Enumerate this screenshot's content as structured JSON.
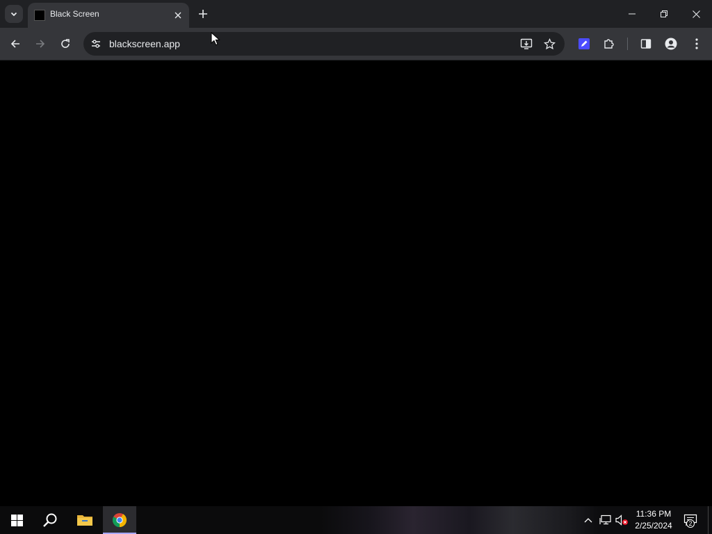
{
  "browser": {
    "tab": {
      "title": "Black Screen",
      "favicon": "black-square-icon"
    },
    "address_bar": {
      "url": "blackscreen.app"
    },
    "colors": {
      "tabstrip": "#202124",
      "toolbar": "#35363a",
      "omnibox": "#202124",
      "page_background": "#000000",
      "extension_accent": "#4c4cff"
    }
  },
  "taskbar": {
    "clock": {
      "time": "11:36 PM",
      "date": "2/25/2024"
    },
    "notifications": {
      "count": "2"
    },
    "colors": {
      "active_underline": "#a8a8ff"
    }
  }
}
